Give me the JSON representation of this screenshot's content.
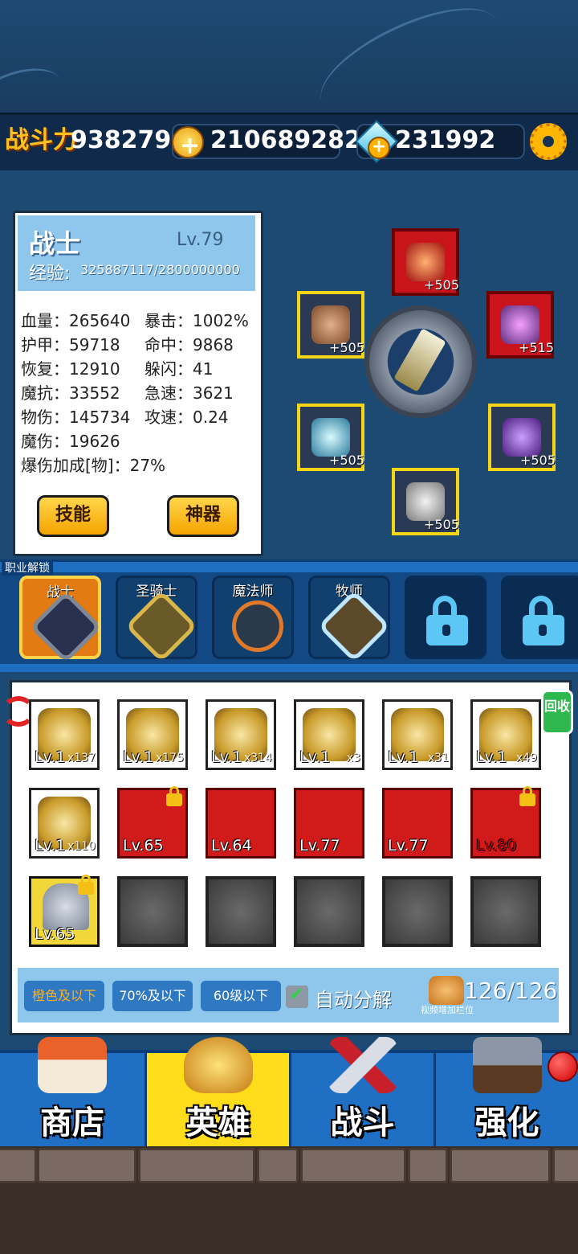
{
  "topbar": {
    "power_label": "战斗力",
    "power_value": "9382790",
    "gold_value": "210689282",
    "gem_value": "231992"
  },
  "hero": {
    "name": "战士",
    "level": "Lv.79",
    "exp_label": "经验:",
    "exp_value": "325887117/2800000000",
    "stats_left": [
      "血量：265640",
      "护甲：59718",
      "恢复：12910",
      "魔抗：33552",
      "物伤：145734",
      "魔伤：19626",
      "爆伤加成[物]：27%"
    ],
    "stats_right": [
      "暴击：1002%",
      "命中：9868",
      "躲闪：41",
      "急速：3621",
      "攻速：0.24"
    ],
    "skill_button": "技能",
    "artifact_button": "神器"
  },
  "equipment": {
    "helmet": "+505",
    "gloves": "+505",
    "weapon": "+515",
    "necklace": "+505",
    "ring": "+505",
    "boots": "+505"
  },
  "class_bar": {
    "title": "职业解锁",
    "classes": [
      "战士",
      "圣骑士",
      "魔法师",
      "牧师"
    ]
  },
  "inventory": {
    "row1": [
      {
        "lv": "Lv.1",
        "count": "x137"
      },
      {
        "lv": "Lv.1",
        "count": "x175"
      },
      {
        "lv": "Lv.1",
        "count": "x314"
      },
      {
        "lv": "Lv.1",
        "count": "x3"
      },
      {
        "lv": "Lv.1",
        "count": "x31"
      },
      {
        "lv": "Lv.1",
        "count": "x49"
      }
    ],
    "row2": [
      {
        "lv": "Lv.1",
        "count": "x110"
      },
      {
        "lv": "Lv.65",
        "count": ""
      },
      {
        "lv": "Lv.64",
        "count": ""
      },
      {
        "lv": "Lv.77",
        "count": ""
      },
      {
        "lv": "Lv.77",
        "count": ""
      },
      {
        "lv": "Lv.80",
        "count": ""
      }
    ],
    "row3": [
      {
        "lv": "Lv.65",
        "count": ""
      }
    ],
    "recycle_label": "回收"
  },
  "filters": {
    "orange_below": "橙色及以下",
    "pct_below": "70%及以下",
    "lv_below": "60级以下",
    "auto_decompose": "自动分解",
    "bag_count": "126/126",
    "bag_sub": "视频增加栏位"
  },
  "nav": {
    "shop": "商店",
    "hero": "英雄",
    "battle": "战斗",
    "upgrade": "强化"
  }
}
